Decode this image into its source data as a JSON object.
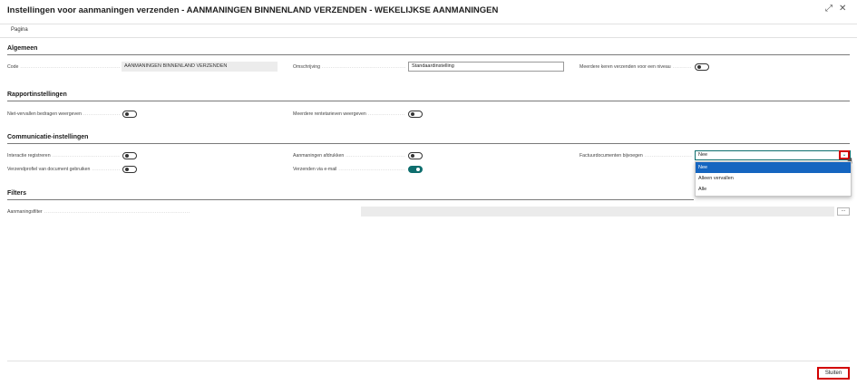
{
  "window": {
    "title": "Instellingen voor aanmaningen verzenden - AANMANINGEN BINNENLAND VERZENDEN - WEKELIJKSE AANMANINGEN",
    "expand_glyph": "⤢",
    "close_glyph": "✕"
  },
  "tabs": {
    "page": "Pagina"
  },
  "general": {
    "heading": "Algemeen",
    "code_label": "Code",
    "code_value": "AANMANINGEN BINNENLAND VERZENDEN",
    "description_label": "Omschrijving",
    "description_value": "Standaardinstelling",
    "multiple_label": "Meerdere keren verzenden voor een niveau",
    "multiple_on": false
  },
  "report": {
    "heading": "Rapportinstellingen",
    "show_not_due_label": "Niet-vervallen bedragen weergeven",
    "show_not_due_on": false,
    "show_multiple_interest_label": "Meerdere rentetarieven weergeven",
    "show_multiple_interest_on": false
  },
  "communication": {
    "heading": "Communicatie-instellingen",
    "log_interaction_label": "Interactie registreren",
    "log_interaction_on": false,
    "print_label": "Aanmaningen afdrukken",
    "print_on": false,
    "attach_invoices_label": "Factuurdocumenten bijvoegen",
    "attach_invoices_value": "Nee",
    "dropdown_glyph": "⌄",
    "send_profile_label": "Verzendprofiel van document gebruiken",
    "send_profile_on": false,
    "email_label": "Verzenden via e-mail",
    "email_on": true,
    "options": [
      "Nee",
      "Alleen vervallen",
      "Alle"
    ],
    "selected_option": "Nee"
  },
  "filters": {
    "heading": "Filters",
    "filter_label": "Aanmaningsfilter",
    "filter_value": "",
    "more_glyph": "..."
  },
  "footer": {
    "close_label": "Sluiten"
  }
}
